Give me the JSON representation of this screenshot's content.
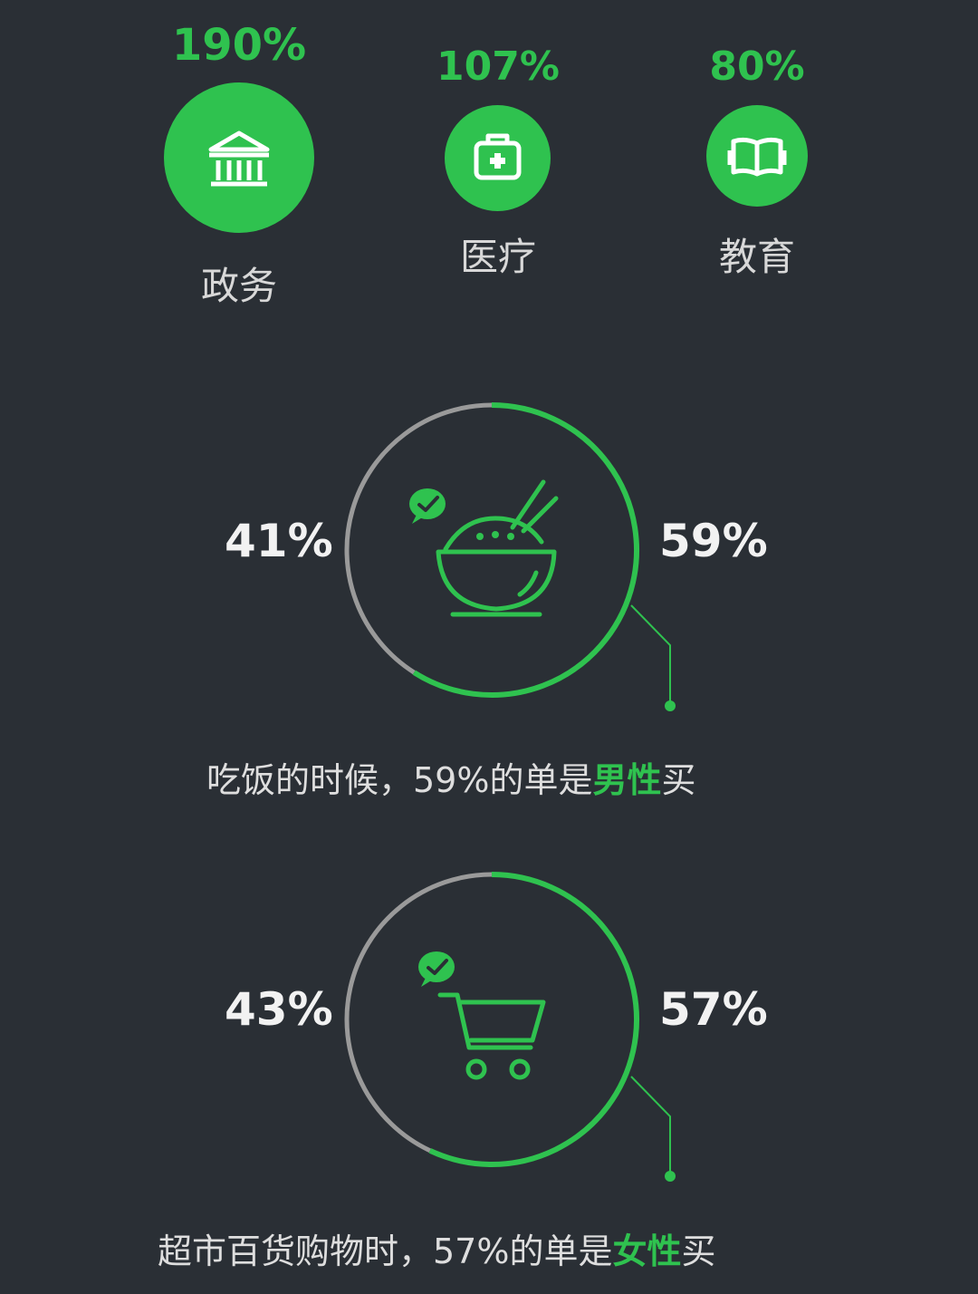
{
  "sectors": [
    {
      "percent": "190%",
      "label": "政务",
      "icon": "government-building-icon"
    },
    {
      "percent": "107%",
      "label": "医疗",
      "icon": "medical-kit-icon"
    },
    {
      "percent": "80%",
      "label": "教育",
      "icon": "open-book-icon"
    }
  ],
  "charts": [
    {
      "left_label": "41%",
      "right_label": "59%",
      "icon": "rice-bowl-icon",
      "caption_prefix": "吃饭的时候，59%的单是",
      "caption_highlight": "男性",
      "caption_suffix": "买"
    },
    {
      "left_label": "43%",
      "right_label": "57%",
      "icon": "shopping-cart-icon",
      "caption_prefix": "超市百货购物时，57%的单是",
      "caption_highlight": "女性",
      "caption_suffix": "买"
    }
  ],
  "colors": {
    "accent": "#2fc24f",
    "muted": "#9a9a9a",
    "background": "#2a2f35"
  },
  "chart_data": [
    {
      "type": "pie",
      "categories": [
        "女性",
        "男性"
      ],
      "values": [
        41,
        59
      ]
    },
    {
      "type": "pie",
      "categories": [
        "男性",
        "女性"
      ],
      "values": [
        43,
        57
      ]
    }
  ]
}
